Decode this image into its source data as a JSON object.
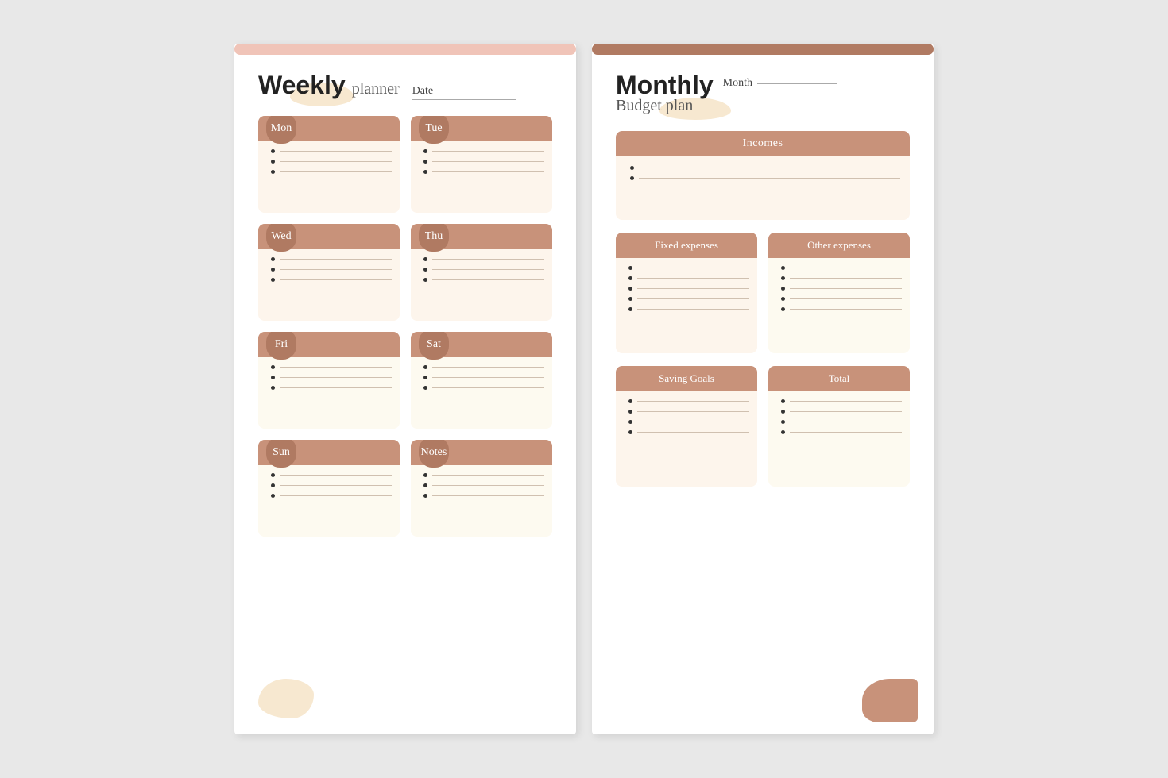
{
  "weekly": {
    "title": "Weekly",
    "subtitle": "planner",
    "date_label": "Date",
    "days": [
      {
        "id": "mon",
        "label": "Mon",
        "lighter": false
      },
      {
        "id": "tue",
        "label": "Tue",
        "lighter": false
      },
      {
        "id": "wed",
        "label": "Wed",
        "lighter": false
      },
      {
        "id": "thu",
        "label": "Thu",
        "lighter": false
      },
      {
        "id": "fri",
        "label": "Fri",
        "lighter": true
      },
      {
        "id": "sat",
        "label": "Sat",
        "lighter": true
      },
      {
        "id": "sun",
        "label": "Sun",
        "lighter": true
      },
      {
        "id": "notes",
        "label": "Notes",
        "lighter": true
      }
    ]
  },
  "monthly": {
    "title": "Monthly",
    "subtitle": "Budget plan",
    "month_label": "Month",
    "sections": {
      "incomes": "Incomes",
      "fixed_expenses": "Fixed expenses",
      "other_expenses": "Other expenses",
      "saving_goals": "Saving Goals",
      "total": "Total"
    }
  }
}
